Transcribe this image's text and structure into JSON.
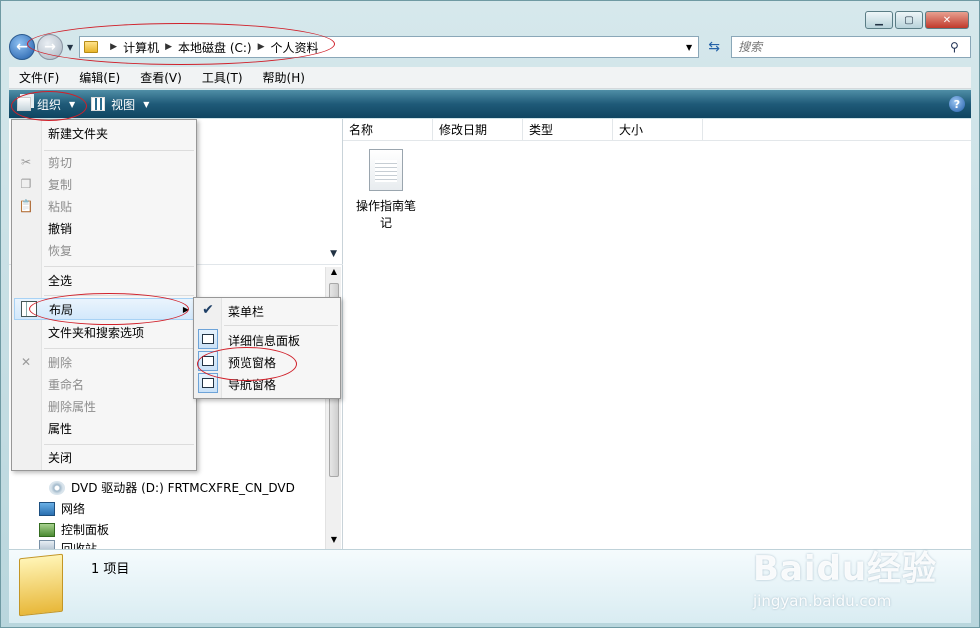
{
  "address": {
    "crumbs": [
      "计算机",
      "本地磁盘 (C:)",
      "个人资料"
    ]
  },
  "search": {
    "placeholder": "搜索"
  },
  "menubar": [
    "文件(F)",
    "编辑(E)",
    "查看(V)",
    "工具(T)",
    "帮助(H)"
  ],
  "cmdbar": {
    "organize": "组织",
    "views": "视图",
    "help": "?"
  },
  "columns": [
    "名称",
    "修改日期",
    "类型",
    "大小"
  ],
  "files": [
    {
      "name": "操作指南笔记"
    }
  ],
  "tree": {
    "dvd": "DVD 驱动器 (D:) FRTMCXFRE_CN_DVD",
    "network": "网络",
    "control_panel": "控制面板",
    "recycle_bin": "回收站"
  },
  "organize_menu": {
    "new_folder": "新建文件夹",
    "cut": "剪切",
    "copy": "复制",
    "paste": "粘贴",
    "undo": "撤销",
    "redo": "恢复",
    "select_all": "全选",
    "layout": "布局",
    "folder_options": "文件夹和搜索选项",
    "delete": "删除",
    "rename": "重命名",
    "remove_properties": "删除属性",
    "properties": "属性",
    "close": "关闭"
  },
  "layout_submenu": {
    "menu_bar": "菜单栏",
    "details_pane": "详细信息面板",
    "preview_pane": "预览窗格",
    "navigation_pane": "导航窗格"
  },
  "status": {
    "items": "1 项目"
  },
  "watermark": {
    "main": "Baidu经验",
    "sub": "jingyan.baidu.com"
  },
  "colors": {
    "command_bar": "#1f5a78",
    "annotation": "#d0202a"
  }
}
